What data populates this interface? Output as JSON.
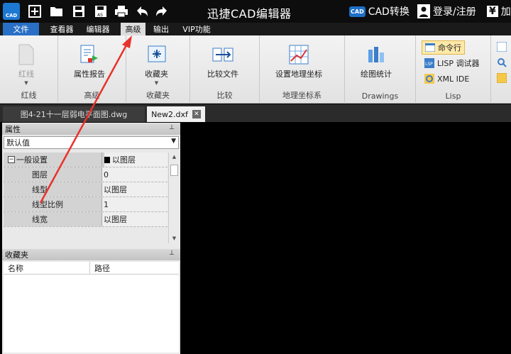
{
  "titlebar": {
    "logo_text": "CAD",
    "app_title": "迅捷CAD编辑器",
    "cad_convert_badge": "CAD",
    "cad_convert": "CAD转换",
    "login": "登录/注册",
    "vip_symbol": "¥",
    "vip_text": "加"
  },
  "menu": {
    "file": "文件",
    "tabs": [
      "查看器",
      "编辑器",
      "高级",
      "输出",
      "VIP功能"
    ],
    "active": "高级"
  },
  "ribbon": {
    "redline": {
      "button": "红线",
      "group": "红线"
    },
    "attr_report": {
      "button": "属性报告",
      "group": "高级"
    },
    "favorites": {
      "button": "收藏夹",
      "group": "收藏夹"
    },
    "compare": {
      "button": "比较文件",
      "group": "比较"
    },
    "geo": {
      "button": "设置地理坐标",
      "group": "地理坐标系"
    },
    "drawings": {
      "button": "绘图统计",
      "group": "Drawings"
    },
    "lisp": {
      "cmdline": "命令行",
      "debugger": "LISP 调试器",
      "xml_ide": "XML IDE",
      "group": "Lisp"
    }
  },
  "doc_tabs": {
    "inactive": "图4-21十一层弱电平面图.dwg",
    "active": "New2.dxf",
    "close": "✕"
  },
  "properties": {
    "title": "属性",
    "pin": "⊥",
    "selector": "默认值",
    "group_label": "一般设置",
    "rows": [
      {
        "name": "色彩",
        "value": "以图层",
        "swatch": true
      },
      {
        "name": "图层",
        "value": "0"
      },
      {
        "name": "线型",
        "value": "以图层"
      },
      {
        "name": "线型比例",
        "value": "1"
      },
      {
        "name": "线宽",
        "value": "以图层"
      }
    ]
  },
  "favorites_panel": {
    "title": "收藏夹",
    "pin": "⊥",
    "col_name": "名称",
    "col_path": "路径"
  },
  "colors": {
    "accent": "#2a6fc6",
    "annotation_arrow": "#e8322b"
  }
}
